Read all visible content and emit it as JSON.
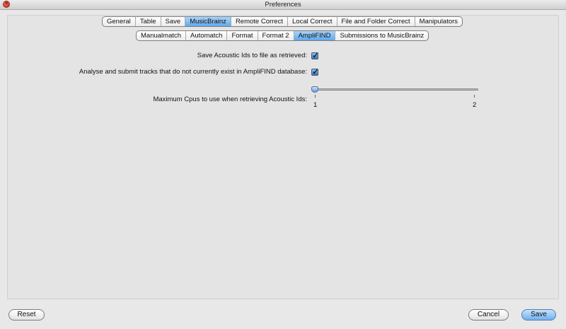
{
  "window": {
    "title": "Preferences"
  },
  "top_tabs": [
    "General",
    "Table",
    "Save",
    "MusicBrainz",
    "Remote Correct",
    "Local Correct",
    "File and Folder Correct",
    "Manipulators"
  ],
  "top_tabs_selected": "MusicBrainz",
  "sub_tabs": [
    "Manualmatch",
    "Automatch",
    "Format",
    "Format 2",
    "AmpliFIND",
    "Submissions to MusicBrainz"
  ],
  "sub_tabs_selected": "AmpliFIND",
  "settings": {
    "save_ids_label": "Save Acoustic Ids to file as retrieved:",
    "save_ids_checked": true,
    "analyse_label": "Analyse and submit tracks that do not currently exist in AmpliFIND database:",
    "analyse_checked": true,
    "max_cpus_label": "Maximum Cpus to use when retrieving Acoustic Ids:",
    "max_cpus_value": 1,
    "max_cpus_min": "1",
    "max_cpus_max": "2"
  },
  "buttons": {
    "reset": "Reset",
    "cancel": "Cancel",
    "save": "Save"
  },
  "colors": {
    "accent": "#5fa8ee",
    "window_bg": "#e8e8e8"
  },
  "icons": {
    "close": "close-icon",
    "check": "check-icon"
  }
}
